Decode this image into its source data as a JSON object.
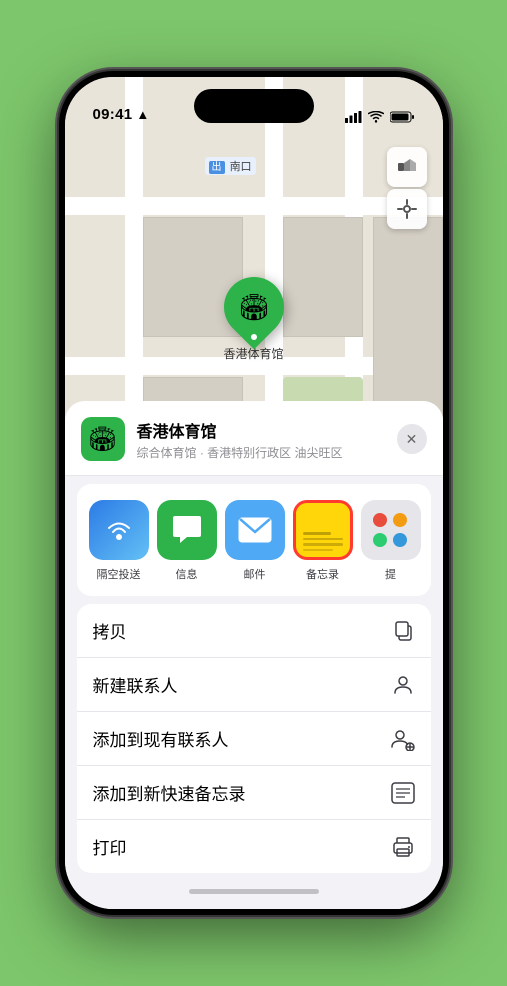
{
  "status_bar": {
    "time": "09:41",
    "location_icon": "▶"
  },
  "map": {
    "label_text": "南口",
    "pin_emoji": "🏟",
    "venue_name_pin": "香港体育馆"
  },
  "sheet": {
    "venue_name": "香港体育馆",
    "venue_sub": "综合体育馆 · 香港特别行政区 油尖旺区",
    "close_label": "✕",
    "venue_emoji": "🏟"
  },
  "share_items": [
    {
      "id": "airdrop",
      "label": "隔空投送",
      "emoji": "📡"
    },
    {
      "id": "message",
      "label": "信息",
      "emoji": "💬"
    },
    {
      "id": "mail",
      "label": "邮件",
      "emoji": "✉️"
    },
    {
      "id": "notes",
      "label": "备忘录",
      "emoji": ""
    },
    {
      "id": "more",
      "label": "提",
      "emoji": ""
    }
  ],
  "actions": [
    {
      "id": "copy",
      "label": "拷贝",
      "icon": "⎘"
    },
    {
      "id": "new-contact",
      "label": "新建联系人",
      "icon": "👤"
    },
    {
      "id": "add-existing",
      "label": "添加到现有联系人",
      "icon": "👤"
    },
    {
      "id": "quick-note",
      "label": "添加到新快速备忘录",
      "icon": "📋"
    },
    {
      "id": "print",
      "label": "打印",
      "icon": "🖨"
    }
  ]
}
